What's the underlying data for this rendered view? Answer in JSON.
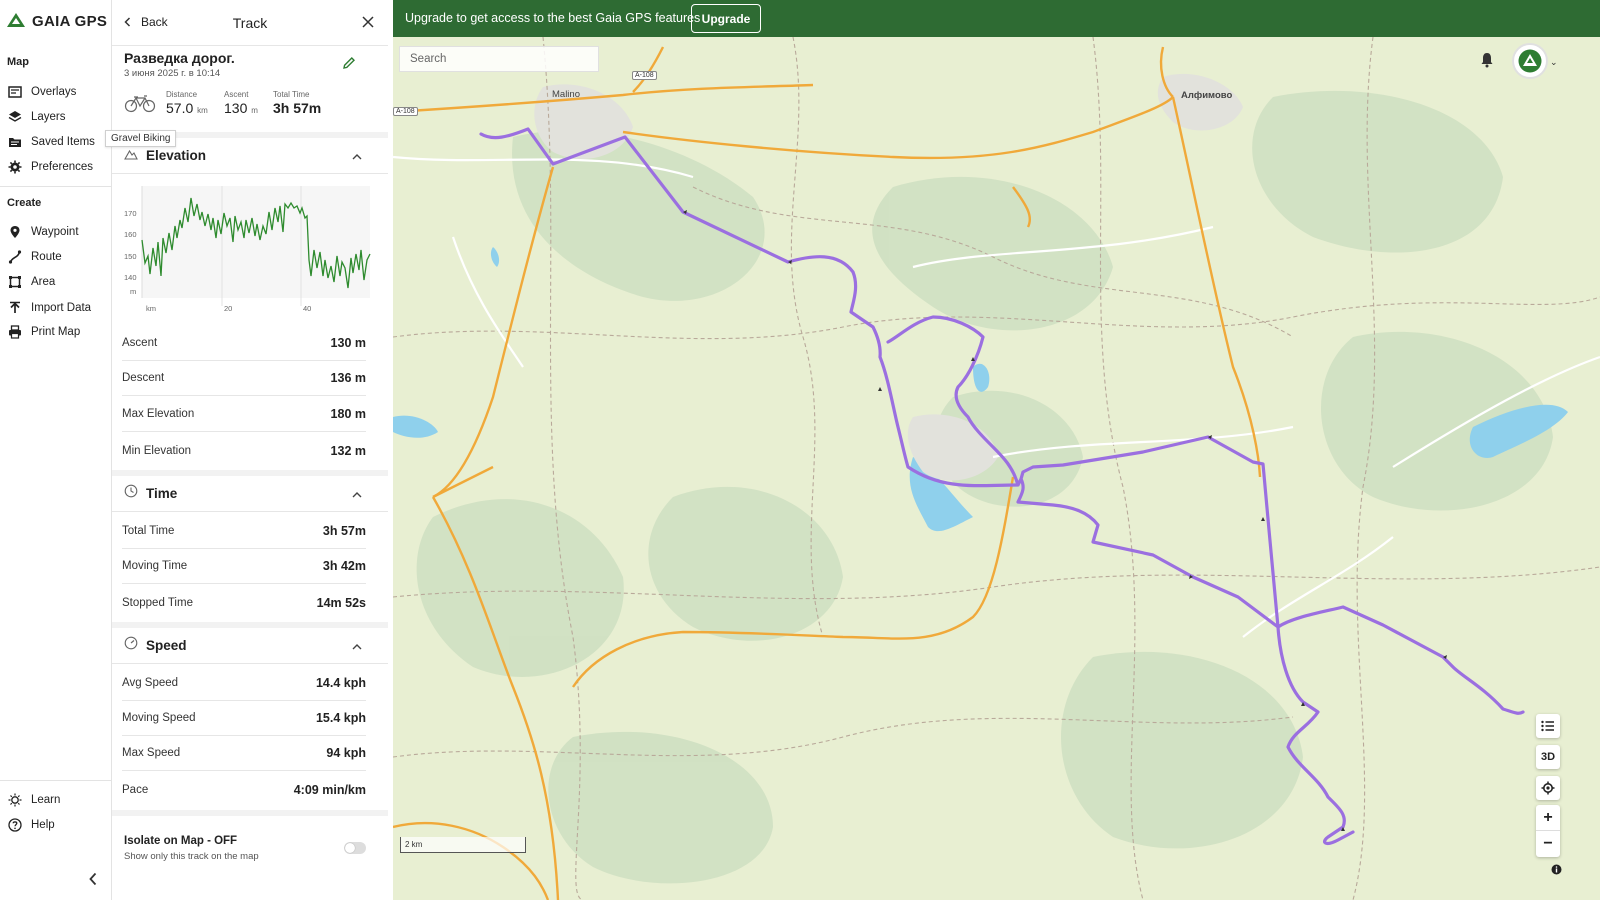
{
  "app": {
    "brand": "GAIA GPS"
  },
  "nav": {
    "map_section": "Map",
    "map_items": [
      {
        "label": "Overlays",
        "icon": "overlays-icon"
      },
      {
        "label": "Layers",
        "icon": "layers-icon"
      },
      {
        "label": "Saved Items",
        "icon": "folder-icon"
      },
      {
        "label": "Preferences",
        "icon": "gear-icon"
      }
    ],
    "create_section": "Create",
    "create_items": [
      {
        "label": "Waypoint",
        "icon": "pin-icon"
      },
      {
        "label": "Route",
        "icon": "route-icon"
      },
      {
        "label": "Area",
        "icon": "area-icon"
      },
      {
        "label": "Import Data",
        "icon": "upload-icon"
      },
      {
        "label": "Print Map",
        "icon": "printer-icon"
      }
    ],
    "learn": "Learn",
    "help": "Help",
    "tooltip": "Gravel Biking"
  },
  "panel": {
    "back_label": "Back",
    "title": "Track",
    "track_name": "Разведка дорог.",
    "track_date": "3 июня 2025 г. в 10:14",
    "summary": {
      "distance_label": "Distance",
      "distance_value": "57.0",
      "distance_unit": "km",
      "ascent_label": "Ascent",
      "ascent_value": "130",
      "ascent_unit": "m",
      "total_label": "Total Time",
      "total_value": "3h 57m"
    },
    "elevation": {
      "title": "Elevation",
      "y_ticks": [
        "170",
        "160",
        "150",
        "140",
        "m"
      ],
      "x_ticks": [
        "km",
        "20",
        "40"
      ],
      "rows": [
        {
          "k": "Ascent",
          "v": "130 m"
        },
        {
          "k": "Descent",
          "v": "136 m"
        },
        {
          "k": "Max Elevation",
          "v": "180 m"
        },
        {
          "k": "Min Elevation",
          "v": "132 m"
        }
      ]
    },
    "time": {
      "title": "Time",
      "rows": [
        {
          "k": "Total Time",
          "v": "3h 57m"
        },
        {
          "k": "Moving Time",
          "v": "3h 42m"
        },
        {
          "k": "Stopped Time",
          "v": "14m 52s"
        }
      ]
    },
    "speed": {
      "title": "Speed",
      "rows": [
        {
          "k": "Avg Speed",
          "v": "14.4 kph"
        },
        {
          "k": "Moving Speed",
          "v": "15.4 kph"
        },
        {
          "k": "Max Speed",
          "v": "94 kph"
        },
        {
          "k": "Pace",
          "v": "4:09 min/km"
        }
      ]
    },
    "isolate_title": "Isolate on Map - OFF",
    "isolate_sub": "Show only this track on the map"
  },
  "banner": {
    "text": "Upgrade to get access to the best Gaia GPS features",
    "button": "Upgrade"
  },
  "map": {
    "search_placeholder": "Search",
    "labels": {
      "malino": "Malino",
      "alfimovo": "Алфимово",
      "a108_1": "A-108",
      "a108_2": "A-108"
    },
    "scale_label": "2 km",
    "btn_3d": "3D",
    "zoom_in": "+",
    "zoom_out": "−",
    "info": "i"
  },
  "colors": {
    "banner": "#2e6b33",
    "track": "#9b6fe0",
    "elevation_line": "#2e8b2e",
    "road": "#f0a93a"
  }
}
